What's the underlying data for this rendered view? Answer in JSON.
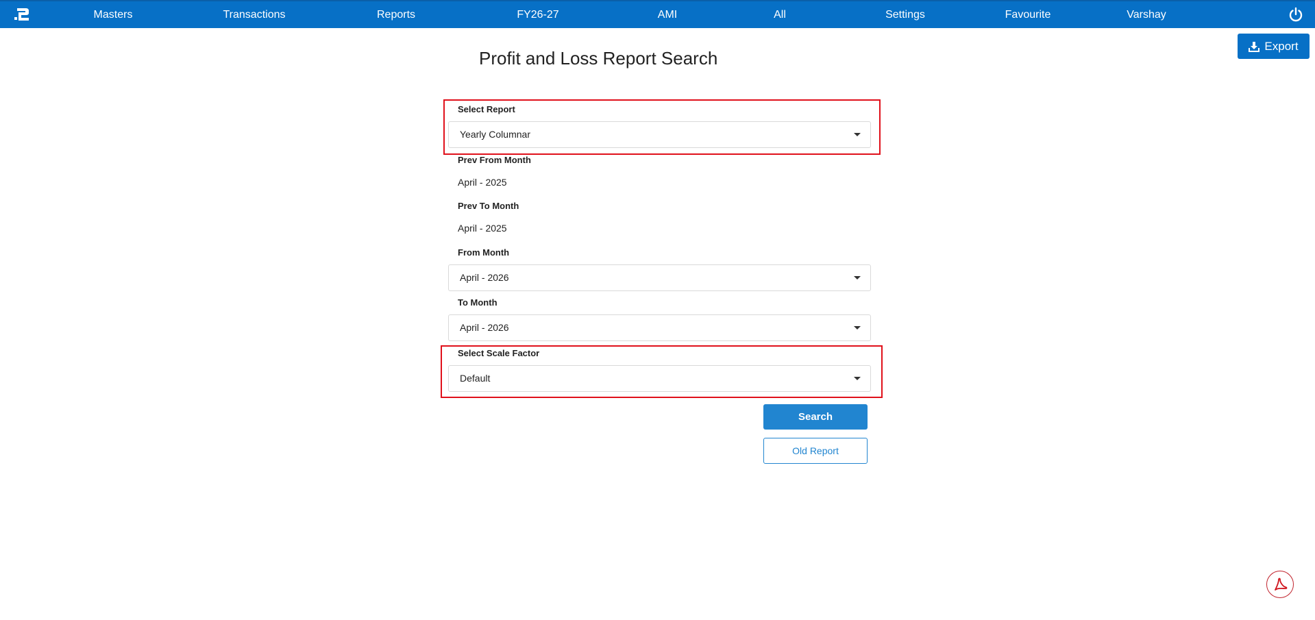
{
  "nav": {
    "logo_icon": "app-logo-icon",
    "items": [
      {
        "label": "Masters"
      },
      {
        "label": "Transactions"
      },
      {
        "label": "Reports"
      },
      {
        "label": "FY26-27"
      },
      {
        "label": "AMI"
      },
      {
        "label": "All"
      },
      {
        "label": "Settings"
      },
      {
        "label": "Favourite"
      },
      {
        "label": "Varshay"
      }
    ],
    "power_icon": "power-icon"
  },
  "export": {
    "label": "Export",
    "icon": "download-icon"
  },
  "page": {
    "title": "Profit and Loss Report Search"
  },
  "form": {
    "select_report": {
      "label": "Select Report",
      "value": "Yearly Columnar"
    },
    "prev_from_month": {
      "label": "Prev From Month",
      "value": "April - 2025"
    },
    "prev_to_month": {
      "label": "Prev To Month",
      "value": "April - 2025"
    },
    "from_month": {
      "label": "From Month",
      "value": "April - 2026"
    },
    "to_month": {
      "label": "To Month",
      "value": "April - 2026"
    },
    "scale_factor": {
      "label": "Select Scale Factor",
      "value": "Default"
    }
  },
  "buttons": {
    "search": "Search",
    "old_report": "Old Report"
  },
  "pdf": {
    "icon": "pdf-icon"
  },
  "colors": {
    "nav_bg": "#0770c6",
    "primary": "#2185d0",
    "highlight": "#e0101a"
  }
}
